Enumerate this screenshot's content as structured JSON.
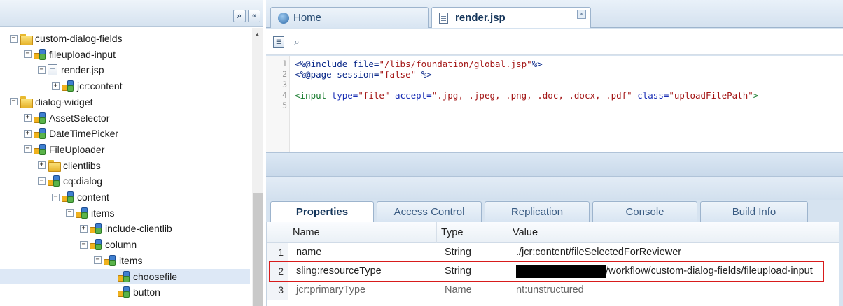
{
  "tree": {
    "toolbar": {
      "find_icon": "binoculars-icon",
      "collapse_icon": "double-chevron-left-icon",
      "find_glyph": "⌕",
      "collapse_glyph": "«"
    },
    "nodes": [
      {
        "label": "custom-dialog-fields",
        "icon": "folder",
        "toggle": "−",
        "depth": 0
      },
      {
        "label": "fileupload-input",
        "icon": "node",
        "toggle": "−",
        "depth": 1
      },
      {
        "label": "render.jsp",
        "icon": "file",
        "toggle": "−",
        "depth": 2
      },
      {
        "label": "jcr:content",
        "icon": "node",
        "toggle": "+",
        "depth": 3
      },
      {
        "label": "dialog-widget",
        "icon": "folder",
        "toggle": "−",
        "depth": 0
      },
      {
        "label": "AssetSelector",
        "icon": "node",
        "toggle": "+",
        "depth": 1
      },
      {
        "label": "DateTimePicker",
        "icon": "node",
        "toggle": "+",
        "depth": 1
      },
      {
        "label": "FileUploader",
        "icon": "node",
        "toggle": "−",
        "depth": 1
      },
      {
        "label": "clientlibs",
        "icon": "folder",
        "toggle": "+",
        "depth": 2
      },
      {
        "label": "cq:dialog",
        "icon": "node",
        "toggle": "−",
        "depth": 2
      },
      {
        "label": "content",
        "icon": "node",
        "toggle": "−",
        "depth": 3
      },
      {
        "label": "items",
        "icon": "node",
        "toggle": "−",
        "depth": 4
      },
      {
        "label": "include-clientlib",
        "icon": "node",
        "toggle": "+",
        "depth": 5
      },
      {
        "label": "column",
        "icon": "node",
        "toggle": "−",
        "depth": 5
      },
      {
        "label": "items",
        "icon": "node",
        "toggle": "−",
        "depth": 6
      },
      {
        "label": "choosefile",
        "icon": "node",
        "toggle": "",
        "depth": 7,
        "selected": true
      },
      {
        "label": "button",
        "icon": "node",
        "toggle": "",
        "depth": 7
      }
    ]
  },
  "editor": {
    "tabs": [
      {
        "label": "Home",
        "icon": "home-icon"
      },
      {
        "label": "render.jsp",
        "icon": "document-icon",
        "close": "×"
      }
    ],
    "toolbar": {
      "view_glyph": "☰",
      "find_glyph": "⌕"
    },
    "lines": [
      {
        "n": "1",
        "segments": [
          {
            "t": "<%@include ",
            "c": "kw"
          },
          {
            "t": "file=",
            "c": "kw"
          },
          {
            "t": "\"/libs/foundation/global.jsp\"",
            "c": "st"
          },
          {
            "t": "%>",
            "c": "kw"
          }
        ]
      },
      {
        "n": "2",
        "segments": [
          {
            "t": "<%@page ",
            "c": "kw"
          },
          {
            "t": "session=",
            "c": "kw"
          },
          {
            "t": "\"false\"",
            "c": "st"
          },
          {
            "t": " %>",
            "c": "kw"
          }
        ]
      },
      {
        "n": "3",
        "segments": []
      },
      {
        "n": "4",
        "segments": [
          {
            "t": "<input ",
            "c": "tg"
          },
          {
            "t": "type=",
            "c": "at"
          },
          {
            "t": "\"file\"",
            "c": "st"
          },
          {
            "t": " accept=",
            "c": "at"
          },
          {
            "t": "\".jpg, .jpeg, .png, .doc, .docx, .pdf\"",
            "c": "st"
          },
          {
            "t": " class=",
            "c": "at"
          },
          {
            "t": "\"uploadFilePath\"",
            "c": "st"
          },
          {
            "t": ">",
            "c": "tg"
          }
        ]
      },
      {
        "n": "5",
        "segments": []
      }
    ]
  },
  "properties": {
    "tabs": [
      "Properties",
      "Access Control",
      "Replication",
      "Console",
      "Build Info"
    ],
    "columns": [
      "Name",
      "Type",
      "Value"
    ],
    "rows": [
      {
        "n": "1",
        "name": "name",
        "type": "String",
        "value": "./jcr:content/fileSelectedForReviewer"
      },
      {
        "n": "2",
        "name": "sling:resourceType",
        "type": "String",
        "value": "/workflow/custom-dialog-fields/fileupload-input",
        "redacted": true
      },
      {
        "n": "3",
        "name": "jcr:primaryType",
        "type": "Name",
        "value": "nt:unstructured"
      }
    ]
  }
}
